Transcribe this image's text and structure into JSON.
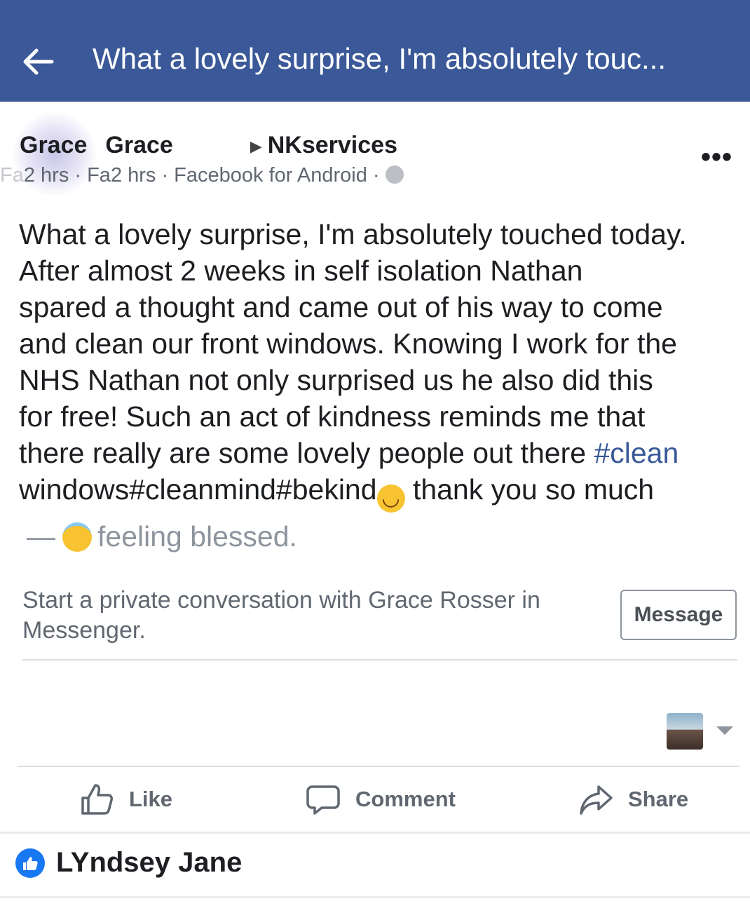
{
  "header": {
    "title": "What a lovely surprise, I'm absolutely touc...",
    "background": "#3b5998"
  },
  "post": {
    "author_ghost": "Grace",
    "author": "Grace",
    "target_page": "NKservices",
    "time_ghost": "2 hrs · Fa",
    "time": "2 hrs · Facebook for Android ·",
    "more_icon": "more-dots-icon",
    "body_lines": [
      "What a lovely surprise, I'm absolutely touched today.",
      "After almost 2 weeks in self isolation Nathan",
      "spared a thought and came out of his way to come",
      "and clean our front windows. Knowing I work for the",
      "NHS Nathan not only surprised us he also did this",
      "for free! Such an act of kindness reminds me that"
    ],
    "body_line7": "there really are some lovely people out there ",
    "hashtag_clean": "#clean",
    "body_line8": "windows#cleanmind#bekind",
    "body_line8_end": " thank you so much",
    "feeling_dash": "—",
    "feeling": "feeling blessed."
  },
  "messenger": {
    "prompt": "Start a private conversation with Grace Rosser in Messenger.",
    "button": "Message"
  },
  "actions": {
    "like": "Like",
    "comment": "Comment",
    "share": "Share"
  },
  "reaction": {
    "name": "LYndsey Jane",
    "icon": "like-badge-icon",
    "color": "#1877f2"
  }
}
